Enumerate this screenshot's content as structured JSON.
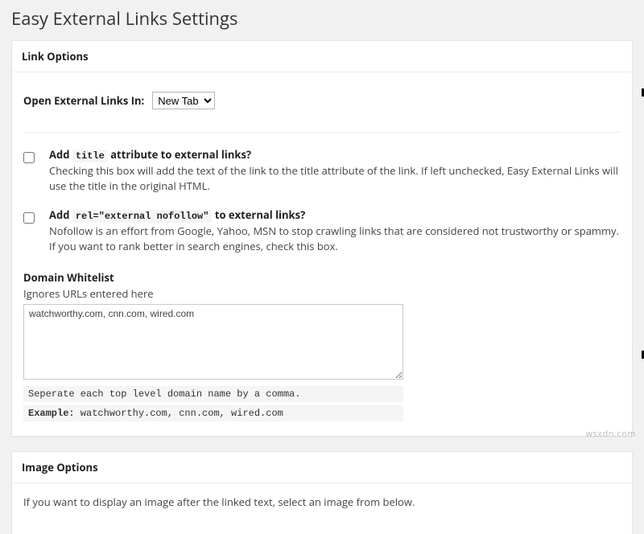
{
  "page": {
    "title": "Easy External Links Settings"
  },
  "linkOptions": {
    "header": "Link Options",
    "openIn": {
      "label": "Open External Links In:",
      "selected": "New Tab"
    },
    "titleAttr": {
      "prefix": "Add ",
      "code": "title",
      "suffix": " attribute to external links?",
      "desc": "Checking this box will add the text of the link to the title attribute of the link. If left unchecked, Easy External Links will use the title in the original HTML."
    },
    "relAttr": {
      "prefix": "Add ",
      "code": "rel=\"external nofollow\"",
      "suffix": " to external links?",
      "desc": "Nofollow is an effort from Google, Yahoo, MSN to stop crawling links that are considered not trustworthy or spammy. If you want to rank better in search engines, check this box."
    },
    "whitelist": {
      "title": "Domain Whitelist",
      "sub": "Ignores URLs entered here",
      "value": "watchworthy.com, cnn.com, wired.com",
      "help1": "Seperate each top level domain name by a comma.",
      "help2_label": "Example:",
      "help2_value": " watchworthy.com, cnn.com, wired.com"
    }
  },
  "imageOptions": {
    "header": "Image Options",
    "desc": "If you want to display an image after the linked text, select an image from below."
  },
  "watermark": "wsxdn.com"
}
